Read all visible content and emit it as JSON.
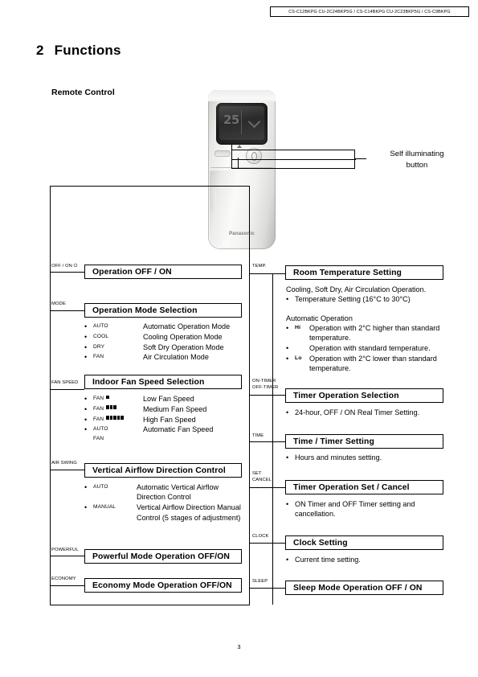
{
  "header": {
    "model_codes": "CS-C12BKPG CU-2C24BKP5G / CS-C14BKPG CU-2C23BKP5G / CS-C9BKPG"
  },
  "chapter": {
    "number": "2",
    "title": "Functions"
  },
  "section": {
    "title": "Remote Control"
  },
  "remote": {
    "lcd_value": "25",
    "brand": "Panasonic"
  },
  "callout": {
    "line1": "Self illuminating",
    "line2": "button"
  },
  "left_column": [
    {
      "tag": "OFF / ON ⏻",
      "title": "Operation OFF / ON",
      "items": []
    },
    {
      "tag": "MODE",
      "title": "Operation Mode Selection",
      "items": [
        {
          "bullet": "•",
          "key": "AUTO",
          "value": "Automatic Operation Mode"
        },
        {
          "bullet": "•",
          "key": "COOL",
          "value": "Cooling Operation Mode"
        },
        {
          "bullet": "•",
          "key": "DRY",
          "value": "Soft Dry Operation Mode"
        },
        {
          "bullet": "•",
          "key": "FAN",
          "value": "Air Circulation Mode"
        }
      ]
    },
    {
      "tag": "FAN SPEED",
      "title": "Indoor Fan Speed Selection",
      "items": [
        {
          "bullet": "•",
          "key": "FAN",
          "bars": 1,
          "value": "Low Fan Speed"
        },
        {
          "bullet": "•",
          "key": "FAN",
          "bars": 3,
          "value": "Medium Fan Speed"
        },
        {
          "bullet": "•",
          "key": "FAN",
          "bars": 5,
          "value": "High Fan Speed"
        },
        {
          "bullet": "•",
          "key": "AUTO",
          "key2": "FAN",
          "value": "Automatic Fan Speed"
        }
      ]
    },
    {
      "tag": "AIR SWING",
      "title": "Vertical Airflow Direction Control",
      "items": [
        {
          "bullet": "•",
          "key": "AUTO",
          "value": "Automatic Vertical Airflow Direction Control"
        },
        {
          "bullet": "•",
          "key": "MANUAL",
          "value": "Vertical Airflow Direction Manual Control (5 stages of adjustment)"
        }
      ]
    },
    {
      "tag": "POWERFUL",
      "title": "Powerful Mode Operation OFF/ON",
      "items": []
    },
    {
      "tag": "ECONOMY",
      "title": "Economy Mode Operation OFF/ON",
      "items": []
    }
  ],
  "right_column": {
    "temp": {
      "tag": "TEMP.",
      "title": "Room Temperature Setting",
      "line_cooling": "Cooling, Soft Dry, Air Circulation Operation.",
      "bullet_temp_setting": "Temperature Setting (16°C to 30°C)",
      "line_auto": "Automatic Operation",
      "auto_items": [
        {
          "glyph": "Hi",
          "value": "Operation with 2°C higher than standard temperature."
        },
        {
          "glyph": "",
          "value": "Operation with standard temperature."
        },
        {
          "glyph": "Lo",
          "value": "Operation with 2°C lower than standard temperature."
        }
      ]
    },
    "timer_selection": {
      "tag_line1": "ON-TIMER",
      "tag_line2": "OFF-TIMER",
      "title": "Timer Operation Selection",
      "bullet": "24-hour, OFF / ON Real Timer Setting."
    },
    "time_setting": {
      "tag": "TIME",
      "title": "Time / Timer Setting",
      "bullet": "Hours and minutes setting."
    },
    "timer_set_cancel": {
      "tag_line1": "SET",
      "tag_line2": "CANCEL",
      "title": "Timer Operation Set / Cancel",
      "bullet": "ON Timer and OFF Timer setting and cancellation."
    },
    "clock": {
      "tag": "CLOCK",
      "title": "Clock Setting",
      "bullet": "Current time setting."
    },
    "sleep": {
      "tag": "SLEEP",
      "title": "Sleep Mode Operation OFF / ON"
    }
  },
  "footer": {
    "page_number": "3"
  }
}
